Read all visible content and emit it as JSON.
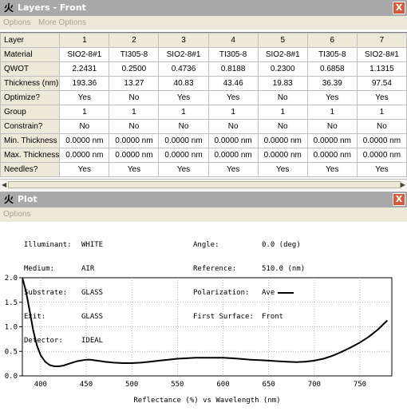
{
  "layers_window": {
    "title": "Layers - Front",
    "icon": "app-logo-icon",
    "close_label": "X",
    "menu": [
      "Options",
      "More Options"
    ]
  },
  "table": {
    "columns": [
      "1",
      "2",
      "3",
      "4",
      "5",
      "6",
      "7"
    ],
    "rows": [
      {
        "label": "Material",
        "values": [
          "SIO2-8#1",
          "TI305-8",
          "SIO2-8#1",
          "TI305-8",
          "SIO2-8#1",
          "TI305-8",
          "SIO2-8#1"
        ]
      },
      {
        "label": "QWOT",
        "values": [
          "2.2431",
          "0.2500",
          "0.4736",
          "0.8188",
          "0.2300",
          "0.6858",
          "1.1315"
        ]
      },
      {
        "label": "Thickness (nm)",
        "values": [
          "193.36",
          "13.27",
          "40.83",
          "43.46",
          "19.83",
          "36.39",
          "97.54"
        ]
      },
      {
        "label": "Optimize?",
        "values": [
          "Yes",
          "No",
          "Yes",
          "Yes",
          "No",
          "Yes",
          "Yes"
        ]
      },
      {
        "label": "Group",
        "values": [
          "1",
          "1",
          "1",
          "1",
          "1",
          "1",
          "1"
        ]
      },
      {
        "label": "Constrain?",
        "values": [
          "No",
          "No",
          "No",
          "No",
          "No",
          "No",
          "No"
        ]
      },
      {
        "label": "Min. Thickness",
        "values": [
          "0.0000 nm",
          "0.0000 nm",
          "0.0000 nm",
          "0.0000 nm",
          "0.0000 nm",
          "0.0000 nm",
          "0.0000 nm"
        ]
      },
      {
        "label": "Max. Thickness",
        "values": [
          "0.0000 nm",
          "0.0000 nm",
          "0.0000 nm",
          "0.0000 nm",
          "0.0000 nm",
          "0.0000 nm",
          "0.0000 nm"
        ]
      },
      {
        "label": "Needles?",
        "values": [
          "Yes",
          "Yes",
          "Yes",
          "Yes",
          "Yes",
          "Yes",
          "Yes"
        ]
      }
    ],
    "header_label": "Layer"
  },
  "plot_window": {
    "title": "Plot",
    "icon": "app-logo-icon",
    "close_label": "X",
    "menu": [
      "Options"
    ],
    "info_left": [
      {
        "key": "Illuminant:",
        "value": "WHITE"
      },
      {
        "key": "Medium:",
        "value": "AIR"
      },
      {
        "key": "Substrate:",
        "value": "GLASS"
      },
      {
        "key": "Exit:",
        "value": "GLASS"
      },
      {
        "key": "Detector:",
        "value": "IDEAL"
      }
    ],
    "info_right": [
      {
        "key": "Angle:",
        "value": "0.0 (deg)"
      },
      {
        "key": "Reference:",
        "value": "510.0 (nm)"
      },
      {
        "key": "Polarization:",
        "value": "Ave"
      },
      {
        "key": "First Surface:",
        "value": "Front"
      }
    ]
  },
  "chart_data": {
    "type": "line",
    "xlabel": "Reflectance (%)   vs   Wavelength (nm)",
    "xlim": [
      380,
      785
    ],
    "ylim": [
      0,
      2.0
    ],
    "xticks": [
      400,
      450,
      500,
      550,
      600,
      650,
      700,
      750
    ],
    "yticks": [
      "0.0",
      "0.5",
      "1.0",
      "1.5",
      "2.0"
    ],
    "grid": true,
    "series": [
      {
        "name": "Ave",
        "x": [
          380,
          384,
          388,
          392,
          396,
          400,
          405,
          410,
          415,
          420,
          425,
          430,
          440,
          450,
          455,
          460,
          470,
          480,
          490,
          500,
          510,
          520,
          530,
          540,
          550,
          560,
          570,
          580,
          590,
          600,
          610,
          620,
          630,
          640,
          650,
          660,
          670,
          680,
          690,
          700,
          710,
          720,
          730,
          740,
          750,
          760,
          770,
          780
        ],
        "y": [
          2.0,
          1.72,
          1.33,
          0.92,
          0.62,
          0.42,
          0.29,
          0.22,
          0.195,
          0.195,
          0.21,
          0.24,
          0.3,
          0.33,
          0.33,
          0.315,
          0.29,
          0.27,
          0.26,
          0.26,
          0.27,
          0.29,
          0.31,
          0.33,
          0.35,
          0.36,
          0.37,
          0.37,
          0.37,
          0.37,
          0.36,
          0.345,
          0.33,
          0.32,
          0.31,
          0.3,
          0.29,
          0.28,
          0.29,
          0.31,
          0.35,
          0.41,
          0.49,
          0.58,
          0.68,
          0.8,
          0.95,
          1.13
        ]
      }
    ],
    "line_color": "#000000"
  },
  "colors": {
    "title_bar": "#a9a9a9",
    "close_button": "#d85a3c",
    "menu_bar": "#ece9d8",
    "grid_line": "#9a9a9a"
  }
}
